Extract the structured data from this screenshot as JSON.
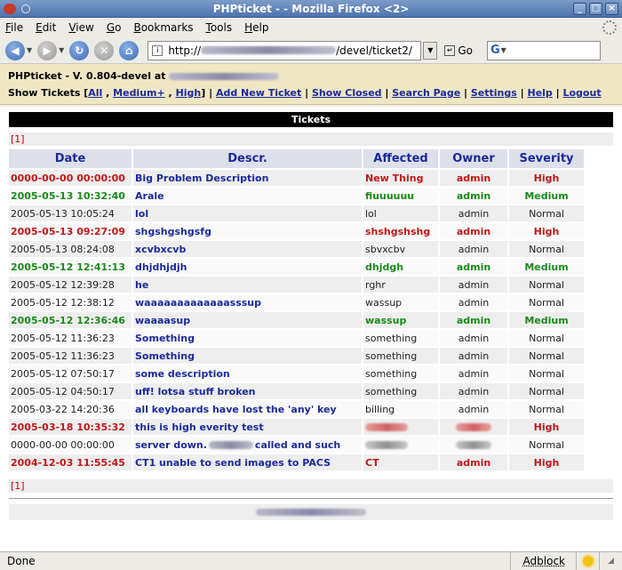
{
  "window": {
    "title": "PHPticket - - Mozilla Firefox <2>"
  },
  "menu": [
    "File",
    "Edit",
    "View",
    "Go",
    "Bookmarks",
    "Tools",
    "Help"
  ],
  "nav": {
    "url_prefix": "http://",
    "url_suffix": "/devel/ticket2/",
    "go_label": "Go"
  },
  "app": {
    "version_prefix": "PHPticket - V. 0.804-devel at",
    "show_tickets_label": "Show Tickets [",
    "filters": [
      "All",
      "Medium+",
      "High"
    ],
    "links": [
      "Add New Ticket",
      "Show Closed",
      "Search Page",
      "Settings",
      "Help",
      "Logout"
    ]
  },
  "tickets": {
    "section_title": "Tickets",
    "pager": "[1]",
    "columns": [
      "Date",
      "Descr.",
      "Affected",
      "Owner",
      "Severity"
    ],
    "rows": [
      {
        "date": "0000-00-00 00:00:00",
        "descr": "Big Problem Description",
        "affected": "New Thing",
        "owner": "admin",
        "severity": "High",
        "level": "high"
      },
      {
        "date": "2005-05-13 10:32:40",
        "descr": "Arale",
        "affected": "fiuuuuuu",
        "owner": "admin",
        "severity": "Medium",
        "level": "medium"
      },
      {
        "date": "2005-05-13 10:05:24",
        "descr": "lol",
        "affected": "lol",
        "owner": "admin",
        "severity": "Normal",
        "level": "normal"
      },
      {
        "date": "2005-05-13 09:27:09",
        "descr": "shgshgshgsfg",
        "affected": "shshgshshg",
        "owner": "admin",
        "severity": "High",
        "level": "high"
      },
      {
        "date": "2005-05-13 08:24:08",
        "descr": "xcvbxcvb",
        "affected": "sbvxcbv",
        "owner": "admin",
        "severity": "Normal",
        "level": "normal"
      },
      {
        "date": "2005-05-12 12:41:13",
        "descr": "dhjdhjdjh",
        "affected": "dhjdgh",
        "owner": "admin",
        "severity": "Medium",
        "level": "medium"
      },
      {
        "date": "2005-05-12 12:39:28",
        "descr": "he",
        "affected": "rghr",
        "owner": "admin",
        "severity": "Normal",
        "level": "normal"
      },
      {
        "date": "2005-05-12 12:38:12",
        "descr": "waaaaaaaaaaaaasssup",
        "affected": "wassup",
        "owner": "admin",
        "severity": "Normal",
        "level": "normal"
      },
      {
        "date": "2005-05-12 12:36:46",
        "descr": "waaaasup",
        "affected": "wassup",
        "owner": "admin",
        "severity": "Medium",
        "level": "medium"
      },
      {
        "date": "2005-05-12 11:36:23",
        "descr": "Something",
        "affected": "something",
        "owner": "admin",
        "severity": "Normal",
        "level": "normal"
      },
      {
        "date": "2005-05-12 11:36:23",
        "descr": "Something",
        "affected": "something",
        "owner": "admin",
        "severity": "Normal",
        "level": "normal"
      },
      {
        "date": "2005-05-12 07:50:17",
        "descr": "some description",
        "affected": "something",
        "owner": "admin",
        "severity": "Normal",
        "level": "normal"
      },
      {
        "date": "2005-05-12 04:50:17",
        "descr": "uff! lotsa stuff broken",
        "affected": "something",
        "owner": "admin",
        "severity": "Normal",
        "level": "normal"
      },
      {
        "date": "2005-03-22 14:20:36",
        "descr": "all keyboards have lost the 'any' key",
        "affected": "billing",
        "owner": "admin",
        "severity": "Normal",
        "level": "normal"
      },
      {
        "date": "2005-03-18 10:35:32",
        "descr": "this is high everity test",
        "affected": "",
        "owner": "",
        "severity": "High",
        "level": "high",
        "redacted": true
      },
      {
        "date": "0000-00-00 00:00:00",
        "descr": "server down.",
        "descr_tail": "called and such",
        "affected": "",
        "owner": "",
        "severity": "Normal",
        "level": "normal",
        "redacted": true
      },
      {
        "date": "2004-12-03 11:55:45",
        "descr": "CT1 unable to send images to PACS",
        "affected": "CT",
        "owner": "admin",
        "severity": "High",
        "level": "high"
      }
    ]
  },
  "status": {
    "text": "Done",
    "adblock": "Adblock"
  }
}
